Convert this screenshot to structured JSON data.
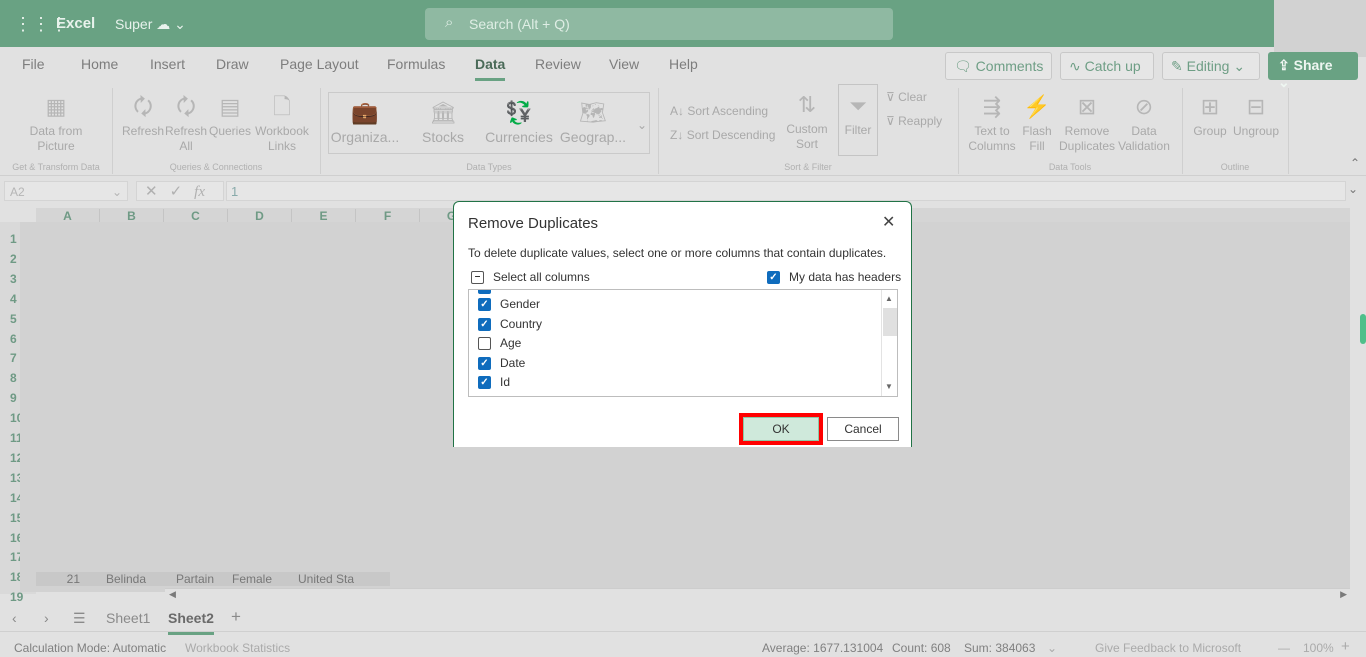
{
  "header": {
    "app_name": "Excel",
    "doc_name": "Super",
    "search_placeholder": "Search (Alt + Q)"
  },
  "menu_tabs": [
    {
      "label": "File"
    },
    {
      "label": "Home"
    },
    {
      "label": "Insert"
    },
    {
      "label": "Draw"
    },
    {
      "label": "Page Layout"
    },
    {
      "label": "Formulas"
    },
    {
      "label": "Data",
      "selected": true
    },
    {
      "label": "Review"
    },
    {
      "label": "View"
    },
    {
      "label": "Help"
    }
  ],
  "actions": {
    "comments": "Comments",
    "catch_up": "Catch up",
    "editing": "Editing",
    "share": "Share"
  },
  "ribbon": {
    "data_from_picture": "Data from Picture",
    "get_transform_group": "Get & Transform Data",
    "refresh": "Refresh",
    "refresh_all": "Refresh All",
    "queries": "Queries",
    "workbook_links": "Workbook Links",
    "queries_group": "Queries & Connections",
    "data_types": [
      "Organiza...",
      "Stocks",
      "Currencies",
      "Geograp..."
    ],
    "data_types_group": "Data Types",
    "sort_ascending": "Sort Ascending",
    "sort_descending": "Sort Descending",
    "custom_sort": "Custom Sort",
    "filter": "Filter",
    "clear": "Clear",
    "reapply": "Reapply",
    "sort_filter_group": "Sort & Filter",
    "text_to_columns": "Text to Columns",
    "flash_fill": "Flash Fill",
    "remove_duplicates": "Remove Duplicates",
    "data_validation": "Data Validation",
    "data_tools_group": "Data Tools",
    "group": "Group",
    "ungroup": "Ungroup",
    "outline_group": "Outline"
  },
  "formula_bar": {
    "name_box": "A2",
    "fx": "fx",
    "value": "1"
  },
  "grid": {
    "columns": [
      "A",
      "B",
      "C",
      "D",
      "E",
      "F",
      "G"
    ],
    "rows": [
      "1",
      "2",
      "3",
      "4",
      "5",
      "6",
      "7",
      "8",
      "9",
      "10",
      "11",
      "12",
      "13",
      "14",
      "15",
      "16",
      "17",
      "18",
      "19"
    ],
    "last_row_cells": [
      "21",
      "Belinda",
      "Partain",
      "Female",
      "United Sta"
    ]
  },
  "sheets": {
    "tabs": [
      "Sheet1",
      "Sheet2"
    ],
    "selected": "Sheet2"
  },
  "status": {
    "calc_mode": "Calculation Mode: Automatic",
    "workbook_stats": "Workbook Statistics",
    "average": "Average: 1677.131004",
    "count": "Count: 608",
    "sum": "Sum: 384063",
    "feedback": "Give Feedback to Microsoft",
    "zoom": "100%"
  },
  "dialog": {
    "title": "Remove Duplicates",
    "description": "To delete duplicate values, select one or more columns that contain duplicates.",
    "select_all": "Select all columns",
    "has_headers": "My data has headers",
    "has_headers_checked": true,
    "columns": [
      {
        "label": "Gender",
        "checked": true
      },
      {
        "label": "Country",
        "checked": true
      },
      {
        "label": "Age",
        "checked": false
      },
      {
        "label": "Date",
        "checked": true
      },
      {
        "label": "Id",
        "checked": true
      }
    ],
    "ok": "OK",
    "cancel": "Cancel"
  },
  "colors": {
    "accent": "#69a283",
    "checkbox": "#0f6cbd",
    "highlight": "#ff0000",
    "ok_bg": "#cfe9db"
  }
}
